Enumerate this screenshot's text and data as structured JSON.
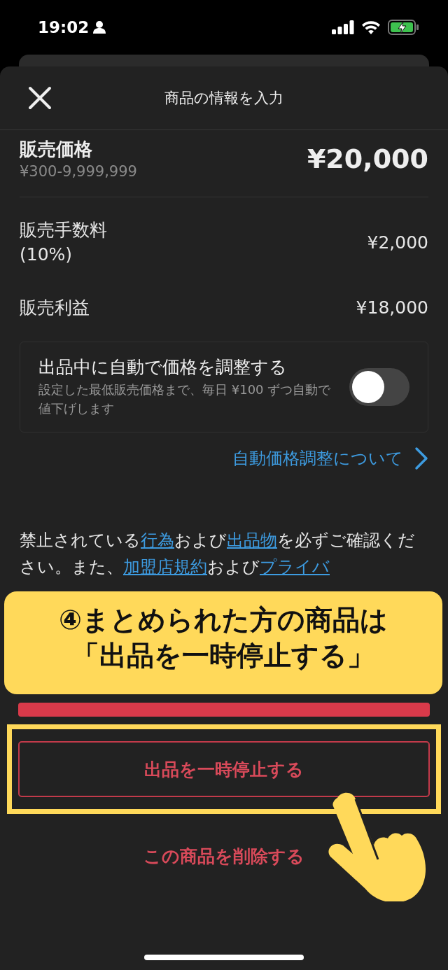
{
  "status_bar": {
    "time": "19:02"
  },
  "header": {
    "title": "商品の情報を入力"
  },
  "price": {
    "label": "販売価格",
    "range": "¥300-9,999,999",
    "value": "¥20,000"
  },
  "rows": [
    {
      "label": "販売手数料\n(10%)",
      "value": "¥2,000"
    },
    {
      "label": "販売利益",
      "value": "¥18,000"
    }
  ],
  "auto_price": {
    "title": "出品中に自動で価格を調整する",
    "description": "設定した最低販売価格まで、毎日 ¥100 ずつ自動で値下げします",
    "on": false
  },
  "info_link": {
    "label": "自動価格調整について"
  },
  "legal_text": [
    {
      "text": "禁止されている",
      "link": false
    },
    {
      "text": "行為",
      "link": true
    },
    {
      "text": "および",
      "link": false
    },
    {
      "text": "出品物",
      "link": true
    },
    {
      "text": "を必ずご確認ください。また、",
      "link": false
    },
    {
      "text": "加盟店規約",
      "link": true
    },
    {
      "text": "および",
      "link": false
    },
    {
      "text": "プライバ",
      "link": true
    }
  ],
  "pause_button": {
    "label": "出品を一時停止する"
  },
  "delete_link": {
    "label": "この商品を削除する"
  },
  "callout": {
    "lines": [
      "④まとめられた方の商品は",
      "「出品を一時停止する」"
    ]
  }
}
